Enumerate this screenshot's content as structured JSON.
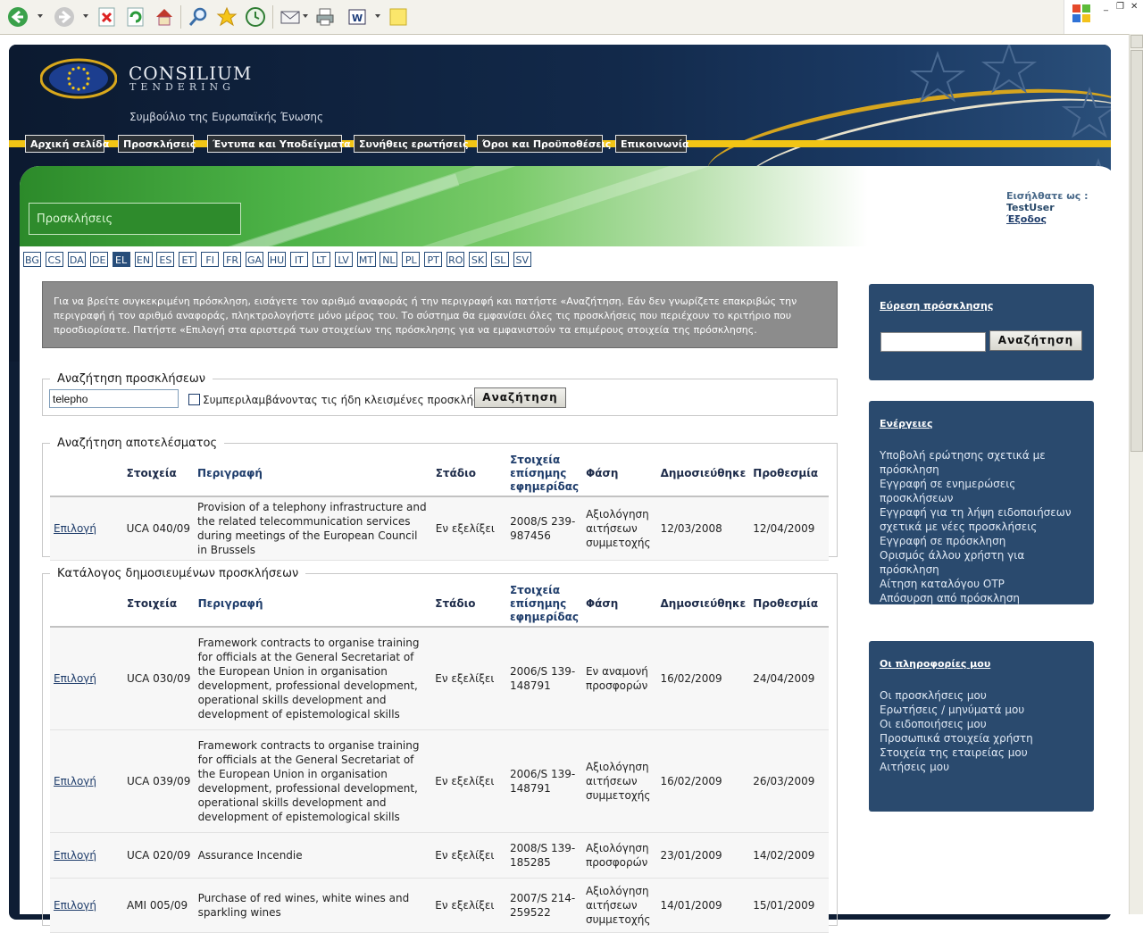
{
  "colors": {
    "navy": "#0e1d34",
    "accent": "#f2c515",
    "panel": "#2a4a6e",
    "green": "#2e8b2c",
    "link": "#1f3d6b"
  },
  "toolbar_icons": [
    "back-icon",
    "forward-icon",
    "stop-icon",
    "refresh-icon",
    "home-icon",
    "search-icon",
    "favorites-icon",
    "history-icon",
    "mail-icon",
    "print-icon",
    "edit-icon",
    "note-icon"
  ],
  "brand": {
    "name": "CONSILIUM",
    "sub": "TENDERING",
    "tagline": "Συμβούλιο της Ευρωπαϊκής Ένωσης"
  },
  "nav": [
    "Αρχική σελίδα",
    "Προσκλήσεις",
    "Έντυπα και Υποδείγματα",
    "Συνήθεις ερωτήσεις",
    "Όροι και Προϋποθέσεις",
    "Επικοινωνία"
  ],
  "page_title": "Προσκλήσεις",
  "login": {
    "label": "Εισήλθατε ως :",
    "user": "TestUser",
    "logout": "Έξοδος"
  },
  "languages": [
    "BG",
    "CS",
    "DA",
    "DE",
    "EL",
    "EN",
    "ES",
    "ET",
    "FI",
    "FR",
    "GA",
    "HU",
    "IT",
    "LT",
    "LV",
    "MT",
    "NL",
    "PL",
    "PT",
    "RO",
    "SK",
    "SL",
    "SV"
  ],
  "active_language": "EL",
  "intro": "Για να βρείτε συγκεκριμένη πρόσκληση, εισάγετε τον αριθμό αναφοράς ή την περιγραφή και πατήστε «Αναζήτηση. Εάν δεν γνωρίζετε επακριβώς την περιγραφή ή τον αριθμό αναφοράς, πληκτρολογήστε μόνο μέρος του. Το σύστημα θα εμφανίσει όλες τις προσκλήσεις που περιέχουν το κριτήριο που προσδιορίσατε. Πατήστε «Επιλογή στα αριστερά των στοιχείων της πρόσκλησης για να εμφανιστούν τα επιμέρους στοιχεία της πρόσκλησης.",
  "search": {
    "legend": "Αναζήτηση προσκλήσεων",
    "value": "telepho",
    "checkbox_label": "Συμπεριλαμβάνοντας τις ήδη κλεισμένες προσκλήσεις",
    "button": "Αναζήτηση"
  },
  "columns": {
    "ref": "Στοιχεία",
    "desc": "Περιγραφή",
    "stage": "Στάδιο",
    "oj1": "Στοιχεία",
    "oj2": "επίσημης",
    "oj3": "εφημερίδας",
    "phase": "Φάση",
    "published": "Δημοσιεύθηκε",
    "deadline": "Προθεσμία"
  },
  "results": {
    "legend": "Αναζήτηση αποτελέσματος",
    "rows": [
      {
        "action": "Επιλογή",
        "ref": "UCA 040/09",
        "desc": "Provision of a telephony infrastructure and the related telecommunication services during meetings of the European Council in Brussels",
        "stage": "Εν εξελίξει",
        "oj": "2008/S 239-987456",
        "phase": "Αξιολόγηση αιτήσεων συμμετοχής",
        "published": "12/03/2008",
        "deadline": "12/04/2009"
      }
    ]
  },
  "catalog": {
    "legend": "Κατάλογος δημοσιευμένων προσκλήσεων",
    "rows": [
      {
        "action": "Επιλογή",
        "ref": "UCA 030/09",
        "desc": "Framework contracts to organise training for officials at the General Secretariat of the European Union in organisation development, professional development, operational skills development and development of epistemological skills",
        "stage": "Εν εξελίξει",
        "oj": "2006/S 139-148791",
        "phase": "Εν αναμονή προσφορών",
        "published": "16/02/2009",
        "deadline": "24/04/2009"
      },
      {
        "action": "Επιλογή",
        "ref": "UCA 039/09",
        "desc": "Framework contracts to organise training for officials at the General Secretariat of the European Union in organisation development, professional development, operational skills development and development of epistemological skills",
        "stage": "Εν εξελίξει",
        "oj": "2006/S 139-148791",
        "phase": "Αξιολόγηση αιτήσεων συμμετοχής",
        "published": "16/02/2009",
        "deadline": "26/03/2009"
      },
      {
        "action": "Επιλογή",
        "ref": "UCA 020/09",
        "desc": "Assurance Incendie",
        "stage": "Εν εξελίξει",
        "oj": "2008/S 139-185285",
        "phase": "Αξιολόγηση προσφορών",
        "published": "23/01/2009",
        "deadline": "14/02/2009"
      },
      {
        "action": "Επιλογή",
        "ref": "AMI 005/09",
        "desc": "Purchase of red wines, white wines and sparkling wines",
        "stage": "Εν εξελίξει",
        "oj": "2007/S 214-259522",
        "phase": "Αξιολόγηση αιτήσεων συμμετοχής",
        "published": "14/01/2009",
        "deadline": "15/01/2009"
      }
    ]
  },
  "panel_search": {
    "title": "Εύρεση πρόσκλησης",
    "button": "Αναζήτηση"
  },
  "panel_actions": {
    "title": "Ενέργειες",
    "items": [
      "Υποβολή ερώτησης σχετικά με πρόσκληση",
      "Εγγραφή σε ενημερώσεις προσκλήσεων",
      "Εγγραφή για τη λήψη ειδοποιήσεων σχετικά με νέες προσκλήσεις",
      "Εγγραφή σε πρόσκληση",
      "Ορισμός άλλου χρήστη για πρόσκληση",
      "Αίτηση καταλόγου OTP",
      "Απόσυρση από πρόσκληση"
    ]
  },
  "panel_info": {
    "title": "Οι πληροφορίες μου",
    "items": [
      "Οι προσκλήσεις μου",
      "Ερωτήσεις / μηνύματά μου",
      "Οι ειδοποιήσεις μου",
      "Προσωπικά στοιχεία χρήστη",
      "Στοιχεία της εταιρείας μου",
      "Αιτήσεις μου"
    ]
  }
}
